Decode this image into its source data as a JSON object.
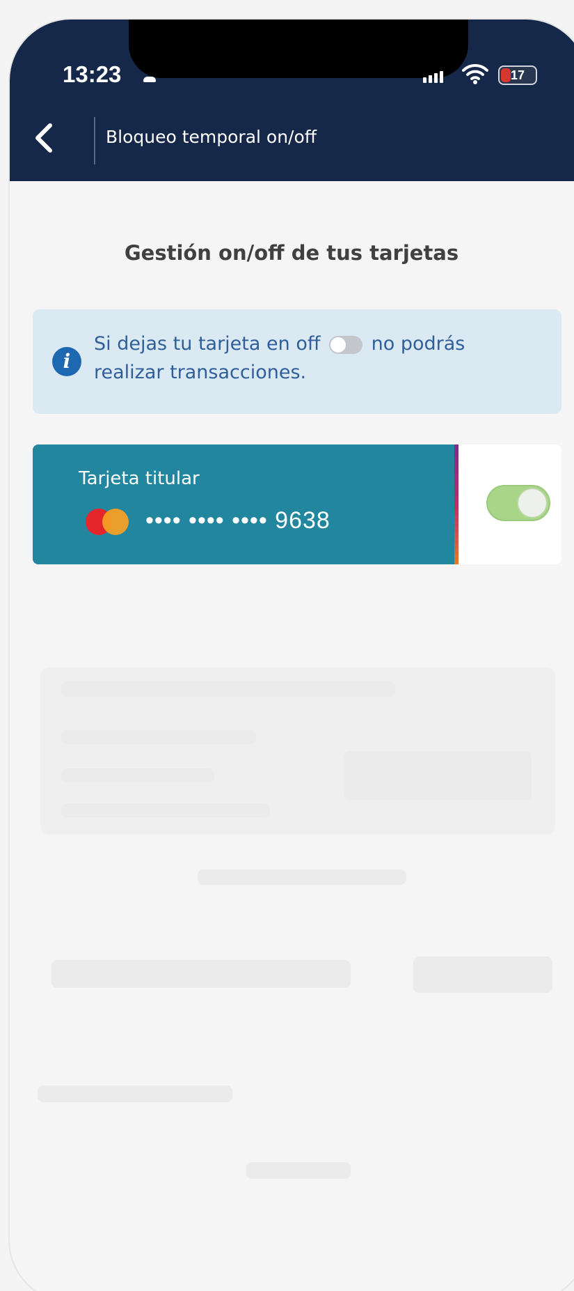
{
  "status_bar": {
    "time": "13:23",
    "battery": "17",
    "battery_level": 0.17
  },
  "nav": {
    "title": "Bloqueo temporal on/off"
  },
  "page": {
    "section_title": "Gestión on/off de tus tarjetas"
  },
  "info": {
    "text_before": "Si dejas tu tarjeta en off",
    "text_after": "no podrás realizar transacciones."
  },
  "card": {
    "label": "Tarjeta titular",
    "number": "•••• •••• •••• 9638",
    "enabled": true
  },
  "colors": {
    "header": "#152849",
    "card": "#23869f",
    "info_bg": "#dbe9f3",
    "toggle_on": "#a9d588"
  }
}
